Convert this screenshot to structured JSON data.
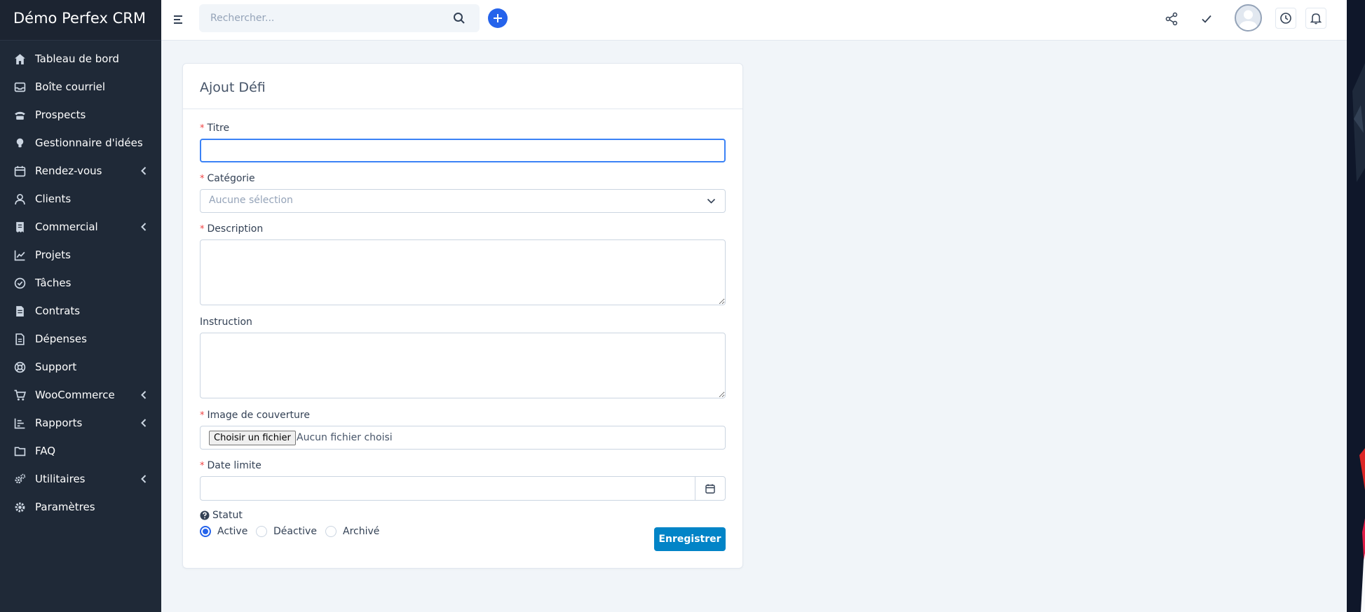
{
  "app": {
    "brand": "Démo Perfex CRM"
  },
  "colors": {
    "sidebar_bg": "#1f2937",
    "accent": "#2563eb",
    "save_button": "#0284c7",
    "required_marker": "#ef4444"
  },
  "sidebar": {
    "items": [
      {
        "label": "Tableau de bord",
        "icon": "home-icon",
        "has_submenu": false
      },
      {
        "label": "Boîte courriel",
        "icon": "inbox-icon",
        "has_submenu": false
      },
      {
        "label": "Prospects",
        "icon": "tty-icon",
        "has_submenu": false
      },
      {
        "label": "Gestionnaire d'idées",
        "icon": "lightbulb-icon",
        "has_submenu": false
      },
      {
        "label": "Rendez-vous",
        "icon": "calendar-icon",
        "has_submenu": true
      },
      {
        "label": "Clients",
        "icon": "user-icon",
        "has_submenu": false
      },
      {
        "label": "Commercial",
        "icon": "receipt-icon",
        "has_submenu": true
      },
      {
        "label": "Projets",
        "icon": "chart-icon",
        "has_submenu": false
      },
      {
        "label": "Tâches",
        "icon": "check-circle-icon",
        "has_submenu": false
      },
      {
        "label": "Contrats",
        "icon": "contract-icon",
        "has_submenu": false
      },
      {
        "label": "Dépenses",
        "icon": "file-invoice-icon",
        "has_submenu": false
      },
      {
        "label": "Support",
        "icon": "lifebuoy-icon",
        "has_submenu": false
      },
      {
        "label": "WooCommerce",
        "icon": "cart-icon",
        "has_submenu": true
      },
      {
        "label": "Rapports",
        "icon": "bar-chart-icon",
        "has_submenu": true
      },
      {
        "label": "FAQ",
        "icon": "folder-icon",
        "has_submenu": false
      },
      {
        "label": "Utilitaires",
        "icon": "cogs-icon",
        "has_submenu": true
      },
      {
        "label": "Paramètres",
        "icon": "gear-icon",
        "has_submenu": false
      }
    ]
  },
  "topbar": {
    "search_placeholder": "Rechercher...",
    "icons": [
      "menu-toggle-icon",
      "search-icon",
      "plus-icon",
      "share-icon",
      "check-icon",
      "avatar",
      "clock-icon",
      "bell-icon"
    ]
  },
  "form": {
    "title": "Ajout Défi",
    "required_marker": "*",
    "titre_label": "Titre",
    "titre_value": "",
    "categorie_label": "Catégorie",
    "categorie_selected": "Aucune sélection",
    "description_label": "Description",
    "description_value": "",
    "instruction_label": "Instruction",
    "instruction_value": "",
    "image_label": "Image de couverture",
    "file_button": "Choisir un fichier",
    "file_none": "Aucun fichier choisi",
    "date_label": "Date limite",
    "date_value": "",
    "statut_label": "Statut",
    "statut_help_icon": "question-circle-icon",
    "statut_options": [
      {
        "label": "Active",
        "checked": true
      },
      {
        "label": "Déactive",
        "checked": false
      },
      {
        "label": "Archivé",
        "checked": false
      }
    ],
    "save_label": "Enregistrer"
  }
}
